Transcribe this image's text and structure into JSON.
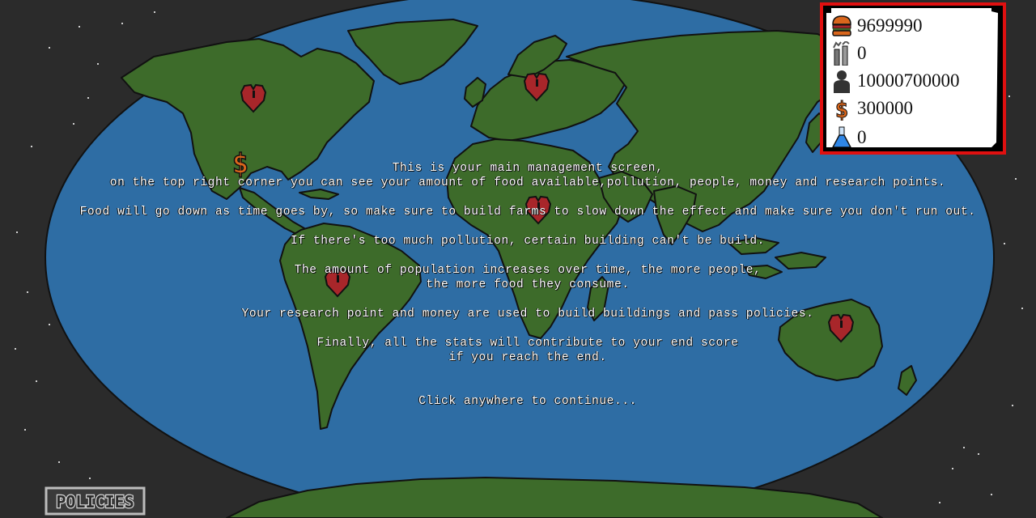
{
  "stats": {
    "food": "9699990",
    "pollution": "0",
    "people": "10000700000",
    "money": "300000",
    "research": "0"
  },
  "intro": {
    "line1": "This is your main management screen,",
    "line2": "on the top right corner you can see your amount of food available,pollution, people, money and research points.",
    "line3": "Food will go down as time goes by, so make sure to build farms to slow down the effect and make sure you don't run out.",
    "line4": "If there's too much pollution, certain building can't be build.",
    "line5": "The amount of population increases over time, the more people,",
    "line6": "the more food they consume.",
    "line7": "Your research point and money are used to build buildings and pass policies.",
    "line8": "Finally, all the stats will contribute to your end score",
    "line9": "if you reach the end.",
    "continue": "Click anywhere to continue..."
  },
  "buttons": {
    "policies": "POLICIES"
  },
  "icons": {
    "food": "burger-icon",
    "pollution": "factory-chimney-icon",
    "people": "person-icon",
    "money": "dollar-icon",
    "research": "flask-icon",
    "map_marker": "heart-marker-icon",
    "money_marker": "dollar-marker-icon"
  },
  "colors": {
    "background": "#2b2b2b",
    "ocean": "#2e6da4",
    "land": "#3d6b2a",
    "marker": "#a8262a",
    "panel_border": "#e01010",
    "dollar": "#d9661c"
  }
}
